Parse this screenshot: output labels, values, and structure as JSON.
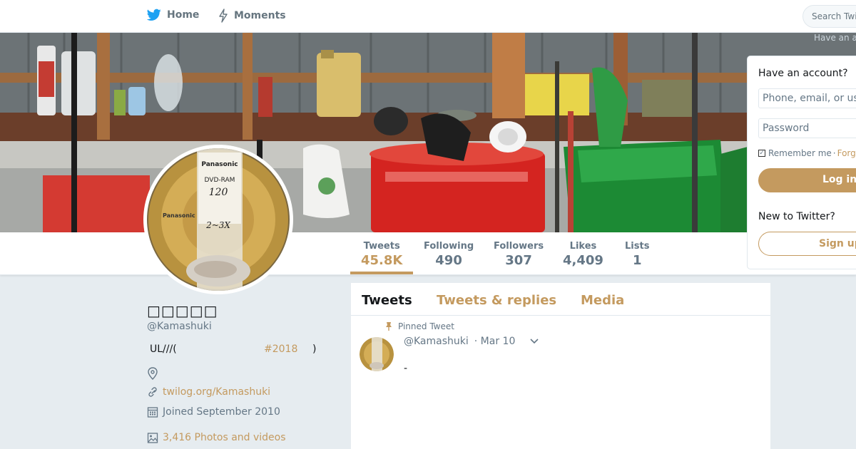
{
  "nav": {
    "home_label": "Home",
    "moments_label": "Moments",
    "search_placeholder": "Search Twi",
    "ghost_text": "Have an a"
  },
  "stats": [
    {
      "label": "Tweets",
      "value": "45.8K"
    },
    {
      "label": "Following",
      "value": "490"
    },
    {
      "label": "Followers",
      "value": "307"
    },
    {
      "label": "Likes",
      "value": "4,409"
    },
    {
      "label": "Lists",
      "value": "1"
    }
  ],
  "profile": {
    "name": "□□□□□",
    "handle": "@Kamashuki",
    "bio_text": "UL///(",
    "bio_hashtag": "#2018",
    "bio_close": ")",
    "url": "twilog.org/Kamashuki",
    "joined": "Joined September 2010",
    "photos": "3,416 Photos and videos"
  },
  "login": {
    "title": "Have an account?",
    "user_placeholder": "Phone, email, or us",
    "password_placeholder": "Password",
    "remember_label": "Remember me",
    "separator": "·",
    "forgot_label": "Forg",
    "login_button": "Log in",
    "new_to": "New to Twitter?",
    "signup_button": "Sign up"
  },
  "timeline": {
    "tabs": [
      "Tweets",
      "Tweets & replies",
      "Media"
    ],
    "pinned_label": "Pinned Tweet",
    "tweet_handle": "@Kamashuki",
    "tweet_date": "· Mar 10",
    "tweet_text": "-"
  },
  "avatar_disc": {
    "brand": "Panasonic",
    "type": "DVD-RAM",
    "capacity": "120",
    "speed": "2~3X"
  },
  "colors": {
    "accent": "#c49a5f",
    "twitter_blue": "#1da1f2",
    "text_secondary": "#657786"
  }
}
